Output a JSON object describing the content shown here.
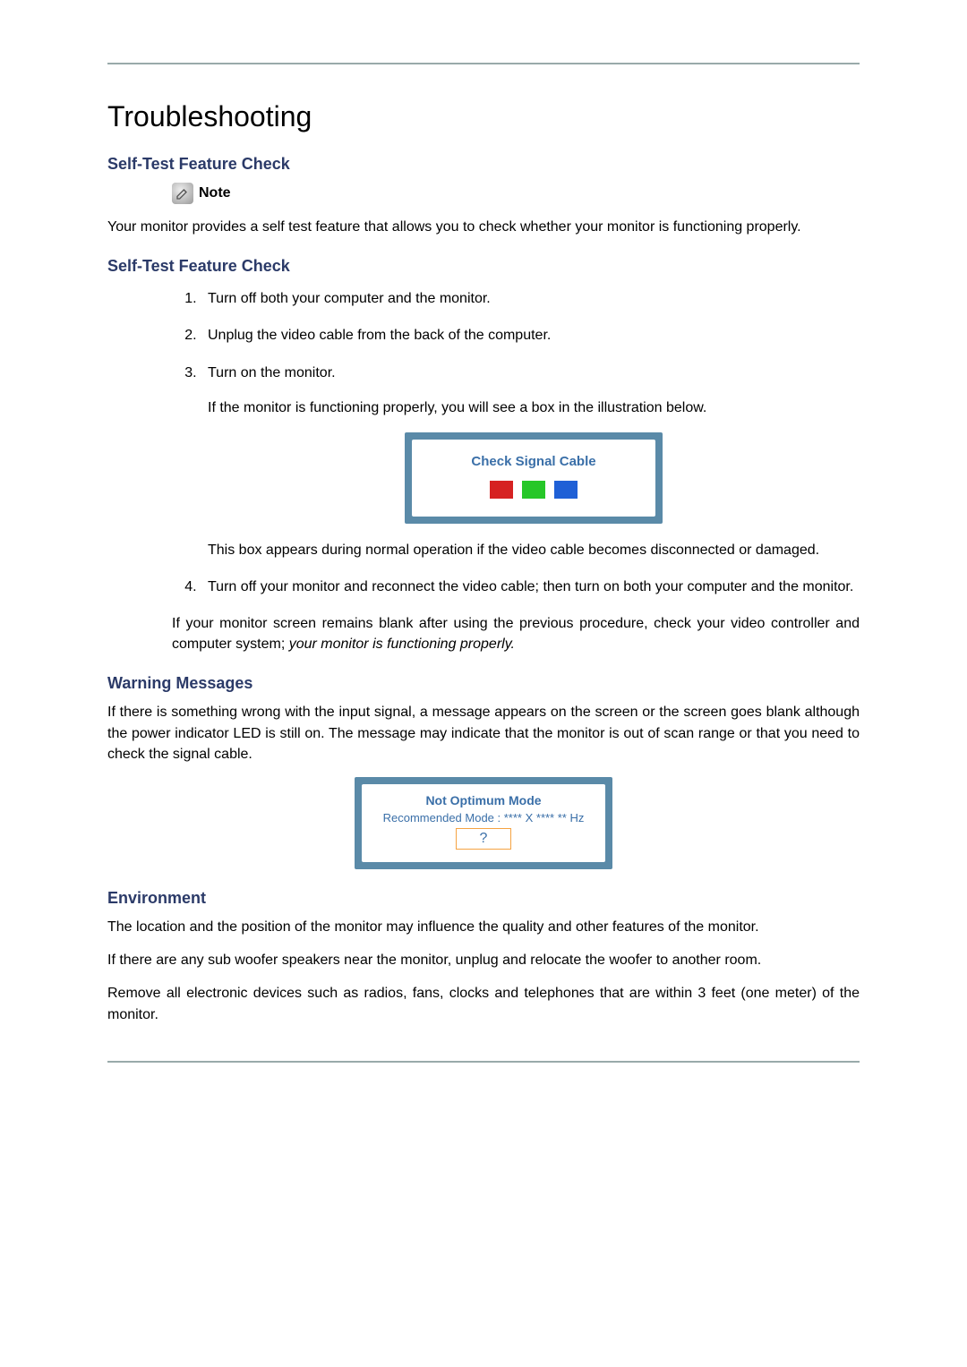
{
  "title": "Troubleshooting",
  "section1": {
    "heading": "Self-Test Feature Check",
    "note_label": "Note",
    "intro": "Your monitor provides a self test feature that allows you to check whether your monitor is functioning properly."
  },
  "section2": {
    "heading": "Self-Test Feature Check",
    "steps": {
      "s1": "Turn off both your computer and the monitor.",
      "s2": "Unplug the video cable from the back of the computer.",
      "s3": "Turn on the monitor.",
      "s3b": "If the monitor is functioning properly, you will see a box in the illustration below.",
      "s3c": "This box appears during normal operation if the video cable becomes disconnected or damaged.",
      "s4": "Turn off your monitor and reconnect the video cable; then turn on both your computer and the monitor."
    },
    "after_a": "If your monitor screen remains blank after using the previous procedure, check your video controller and computer system; ",
    "after_italic": "your monitor is functioning properly.",
    "osd1_title": "Check Signal Cable"
  },
  "section3": {
    "heading": "Warning Messages",
    "body": "If there is something wrong with the input signal, a message appears on the screen or the screen goes blank although the power indicator LED is still on. The message may indicate that the monitor is out of scan range or that you need to check the signal cable.",
    "osd_title": "Not Optimum Mode",
    "osd_sub": "Recommended Mode : **** X **** ** Hz",
    "osd_btn": "?"
  },
  "section4": {
    "heading": "Environment",
    "p1": "The location and the position of the monitor may influence the quality and other features of the monitor.",
    "p2": "If there are any sub woofer speakers near the monitor, unplug and relocate the woofer to another room.",
    "p3": "Remove all electronic devices such as radios, fans, clocks and telephones that are within 3 feet (one meter) of the monitor."
  }
}
